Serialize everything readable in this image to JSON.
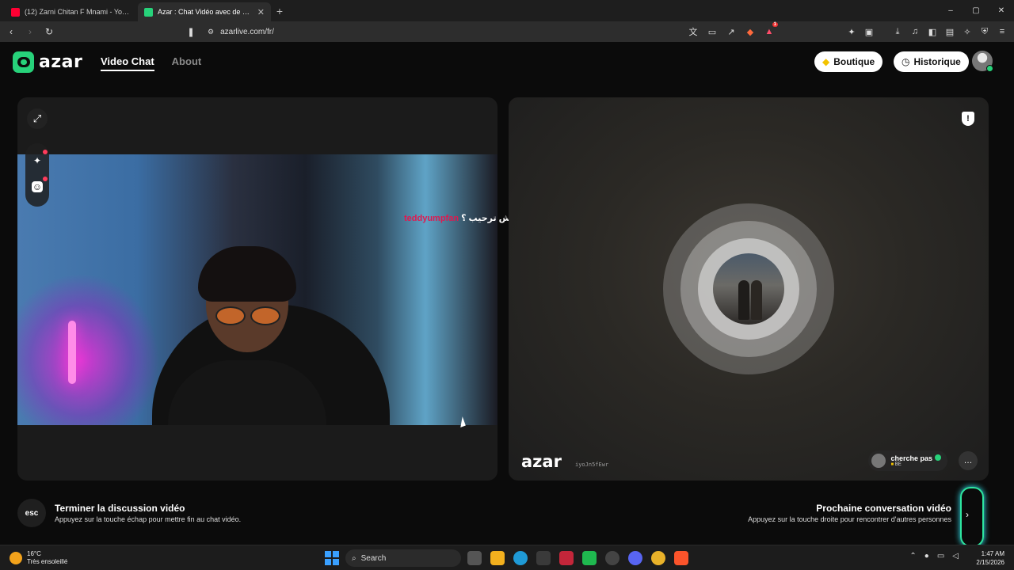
{
  "browser": {
    "tabs": [
      {
        "label": "(12) Zarni Chitan F Mnami - YouTube",
        "active": false,
        "favicon_color": "#ff0033"
      },
      {
        "label": "Azar : Chat Vidéo avec de nou",
        "active": true,
        "favicon_color": "#27d27a"
      }
    ],
    "new_tab": "+",
    "window_controls": [
      "–",
      "▢",
      "✕"
    ],
    "url": "azarlive.com/fr/",
    "extension_badge": "1"
  },
  "header": {
    "logo_text": "azar",
    "nav": [
      {
        "label": "Video Chat",
        "active": true
      },
      {
        "label": "About",
        "active": false
      }
    ],
    "shop_button": "Boutique",
    "history_button": "Historique",
    "accent": "#27d27a"
  },
  "left_panel": {
    "caption_user": "teddyumpfan",
    "caption_text": "كاش ترحيب ؟",
    "tools": [
      "expand-icon",
      "magic-wand-icon",
      "sticker-icon"
    ]
  },
  "right_panel": {
    "watermark": "azar",
    "session_code": "iyoJn5fEwr",
    "peer": {
      "name": "cherche pas",
      "country": "BE"
    }
  },
  "footer": {
    "esc_key": "esc",
    "end_title": "Terminer la discussion vidéo",
    "end_sub": "Appuyez sur la touche échap pour mettre fin au chat vidéo.",
    "next_title": "Prochaine conversation vidéo",
    "next_sub": "Appuyez sur la touche droite pour rencontrer d'autres personnes"
  },
  "taskbar": {
    "weather_temp": "16°C",
    "weather_desc": "Très ensoleillé",
    "search_placeholder": "Search",
    "time": "1:47 AM",
    "date": "2/15/2026"
  }
}
